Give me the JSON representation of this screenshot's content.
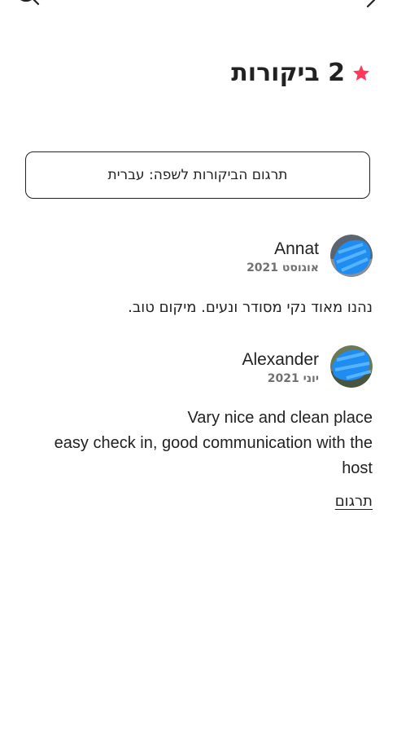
{
  "header": {
    "title": "2 ביקורות",
    "star_color": "#FF385C",
    "icons": [
      "search-icon",
      "back-icon"
    ]
  },
  "translate_button": {
    "label": "תרגום הביקורות לשפה: עברית"
  },
  "reviews": [
    {
      "name": "Annat",
      "date": "אוגוסט 2021",
      "text_lines": [
        "נהנו מאוד נקי מסודר ונעים. מיקום טוב."
      ]
    },
    {
      "name": "Alexander",
      "date": "יוני 2021",
      "text_lines": [
        "Vary nice and clean place",
        "easy check in, good communication with the",
        "host"
      ],
      "translate_label": "תרגום"
    }
  ]
}
